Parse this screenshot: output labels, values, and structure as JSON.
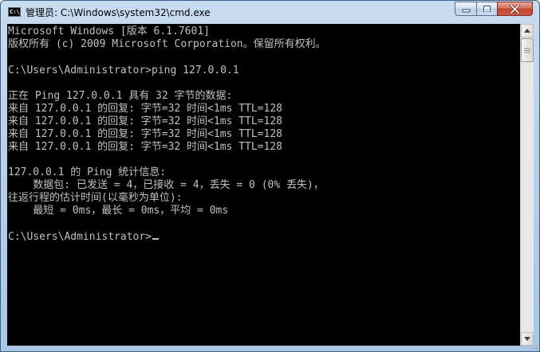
{
  "window": {
    "title": "管理员: C:\\Windows\\system32\\cmd.exe",
    "icon_label": "C:\\"
  },
  "console": {
    "lines": [
      "Microsoft Windows [版本 6.1.7601]",
      "版权所有 (c) 2009 Microsoft Corporation。保留所有权利。",
      "",
      "C:\\Users\\Administrator>ping 127.0.0.1",
      "",
      "正在 Ping 127.0.0.1 具有 32 字节的数据:",
      "来自 127.0.0.1 的回复: 字节=32 时间<1ms TTL=128",
      "来自 127.0.0.1 的回复: 字节=32 时间<1ms TTL=128",
      "来自 127.0.0.1 的回复: 字节=32 时间<1ms TTL=128",
      "来自 127.0.0.1 的回复: 字节=32 时间<1ms TTL=128",
      "",
      "127.0.0.1 的 Ping 统计信息:",
      "    数据包: 已发送 = 4，已接收 = 4，丢失 = 0 (0% 丢失)，",
      "往返行程的估计时间(以毫秒为单位):",
      "    最短 = 0ms，最长 = 0ms，平均 = 0ms",
      "",
      "C:\\Users\\Administrator>"
    ]
  },
  "colors": {
    "console_bg": "#000000",
    "console_fg": "#c0c0c0",
    "close_button": "#c4452e"
  }
}
